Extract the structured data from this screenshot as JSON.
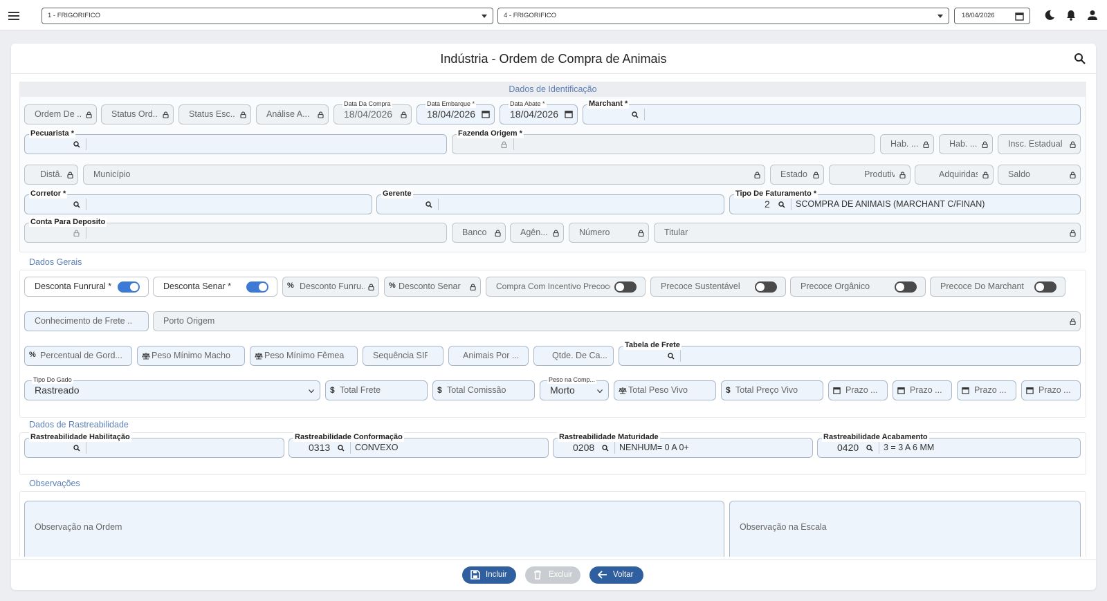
{
  "topbar": {
    "empresa": "1 - FRIGORIFICO",
    "filial": "4 - FRIGORIFICO",
    "data": "18/04/2026"
  },
  "page": {
    "title": "Indústria - Ordem de Compra de Animais"
  },
  "sections": {
    "identificacao": "Dados de Identificação",
    "gerais": "Dados Gerais",
    "rastreabilidade": "Dados de Rastreabilidade",
    "observacoes": "Observações"
  },
  "ident": {
    "ordem": "Ordem De ...",
    "status_ordem": "Status Ord...",
    "status_escala": "Status Esc...",
    "analise": "Análise A...",
    "data_compra_label": "Data Da Compra",
    "data_compra": "18/04/2026",
    "data_embarque_label": "Data Embarque *",
    "data_embarque": "18/04/2026",
    "data_abate_label": "Data Abate *",
    "data_abate": "18/04/2026",
    "marchant_label": "Marchant *",
    "pecuarista_label": "Pecuarista *",
    "fazenda_label": "Fazenda Origem *",
    "hab1": "Hab. ...",
    "hab2": "Hab. ...",
    "insc_estadual": "Insc. Estadual",
    "distancia": "Distâ...",
    "municipio": "Município",
    "estado": "Estado",
    "produtiv": "Produtiv. An...",
    "adquiridas": "Adquiridas",
    "saldo": "Saldo",
    "corretor_label": "Corretor *",
    "gerente_label": "Gerente",
    "tipo_fat_label": "Tipo De Faturamento *",
    "tipo_fat_code": "2",
    "tipo_fat_desc": "SCOMPRA DE ANIMAIS (MARCHANT C/FINAN)",
    "conta_label": "Conta Para Deposito",
    "banco": "Banco",
    "agencia": "Agên...",
    "numero": "Número",
    "titular": "Titular"
  },
  "gerais": {
    "desconta_funrural": "Desconta Funrural *",
    "desconta_senar": "Desconta Senar *",
    "desconto_funrural": "Desconto Funru...",
    "desconto_senar": "Desconto Senar",
    "incentivo": "Compra Com Incentivo Precoce",
    "sustentavel": "Precoce Sustentável",
    "organico": "Precoce Orgânico",
    "marchant": "Precoce Do Marchant",
    "conhecimento": "Conhecimento de Frete ...",
    "porto": "Porto Origem",
    "perc_gordura": "Percentual de Gord...",
    "peso_macho": "Peso Mínimo Macho",
    "peso_femea": "Peso Mínimo Fêmea",
    "sequencia": "Sequência SIF",
    "animais": "Animais Por ...",
    "qtde": "Qtde. De Ca...",
    "tabela_frete_label": "Tabela de Frete",
    "tipo_gado_label": "Tipo Do Gado",
    "tipo_gado": "Rastreado",
    "total_frete": "Total Frete",
    "total_comissao": "Total Comissão",
    "peso_comp_label": "Peso na Comp...",
    "peso_comp": "Morto",
    "total_peso_vivo": "Total Peso Vivo",
    "total_preco_vivo": "Total Preço Vivo",
    "prazo1": "Prazo ...",
    "prazo2": "Prazo ...",
    "prazo3": "Prazo ...",
    "prazo4": "Prazo ..."
  },
  "toggles": {
    "desconta_funrural": true,
    "desconta_senar": true,
    "incentivo": false,
    "sustentavel": false,
    "organico": false,
    "marchant": false
  },
  "rastro": {
    "habilitacao_label": "Rastreabilidade Habilitação",
    "conformacao_label": "Rastreabilidade Conformação",
    "conformacao_code": "0313",
    "conformacao_desc": "CONVEXO",
    "maturidade_label": "Rastreabilidade Maturidade",
    "maturidade_code": "0208",
    "maturidade_desc": "NENHUM= 0 A 0+",
    "acabamento_label": "Rastreabilidade Acabamento",
    "acabamento_code": "0420",
    "acabamento_desc": "3 = 3 A 6 MM"
  },
  "obs": {
    "ordem": "Observação na Ordem",
    "escala": "Observação na Escala"
  },
  "buttons": {
    "incluir": "Incluir",
    "excluir": "Excluir",
    "voltar": "Voltar"
  },
  "colors": {
    "accent": "#3d7ad6",
    "primary_button": "#2f5f9e",
    "section_title": "#5b7fb5"
  }
}
